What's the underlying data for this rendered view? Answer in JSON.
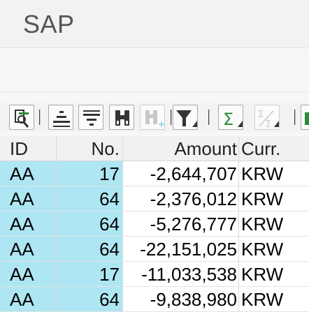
{
  "app": {
    "title": "SAP"
  },
  "toolbar": {
    "buttons": [
      {
        "icon": "details-icon"
      },
      {
        "icon": "sort-ascending-icon"
      },
      {
        "icon": "sort-descending-icon"
      },
      {
        "icon": "find-icon"
      },
      {
        "icon": "find-next-icon"
      },
      {
        "icon": "filter-icon"
      },
      {
        "icon": "total-icon"
      },
      {
        "icon": "subtotal-icon"
      }
    ]
  },
  "table": {
    "columns": [
      "ID",
      "No.",
      "Amount",
      "Curr."
    ],
    "rows": [
      {
        "id": "AA",
        "no": "17",
        "amount": "-2,644,707",
        "curr": "KRW"
      },
      {
        "id": "AA",
        "no": "64",
        "amount": "-2,376,012",
        "curr": "KRW"
      },
      {
        "id": "AA",
        "no": "64",
        "amount": "-5,276,777",
        "curr": "KRW"
      },
      {
        "id": "AA",
        "no": "64",
        "amount": "-22,151,025",
        "curr": "KRW"
      },
      {
        "id": "AA",
        "no": "17",
        "amount": "-11,033,538",
        "curr": "KRW"
      },
      {
        "id": "AA",
        "no": "64",
        "amount": "-9,838,980",
        "curr": "KRW"
      }
    ]
  },
  "colors": {
    "key_column_bg": "#aee6f3",
    "header_bg": "#f1f1f1",
    "toolbar_icon": "#333333",
    "sum_icon": "#2a8a3a"
  }
}
